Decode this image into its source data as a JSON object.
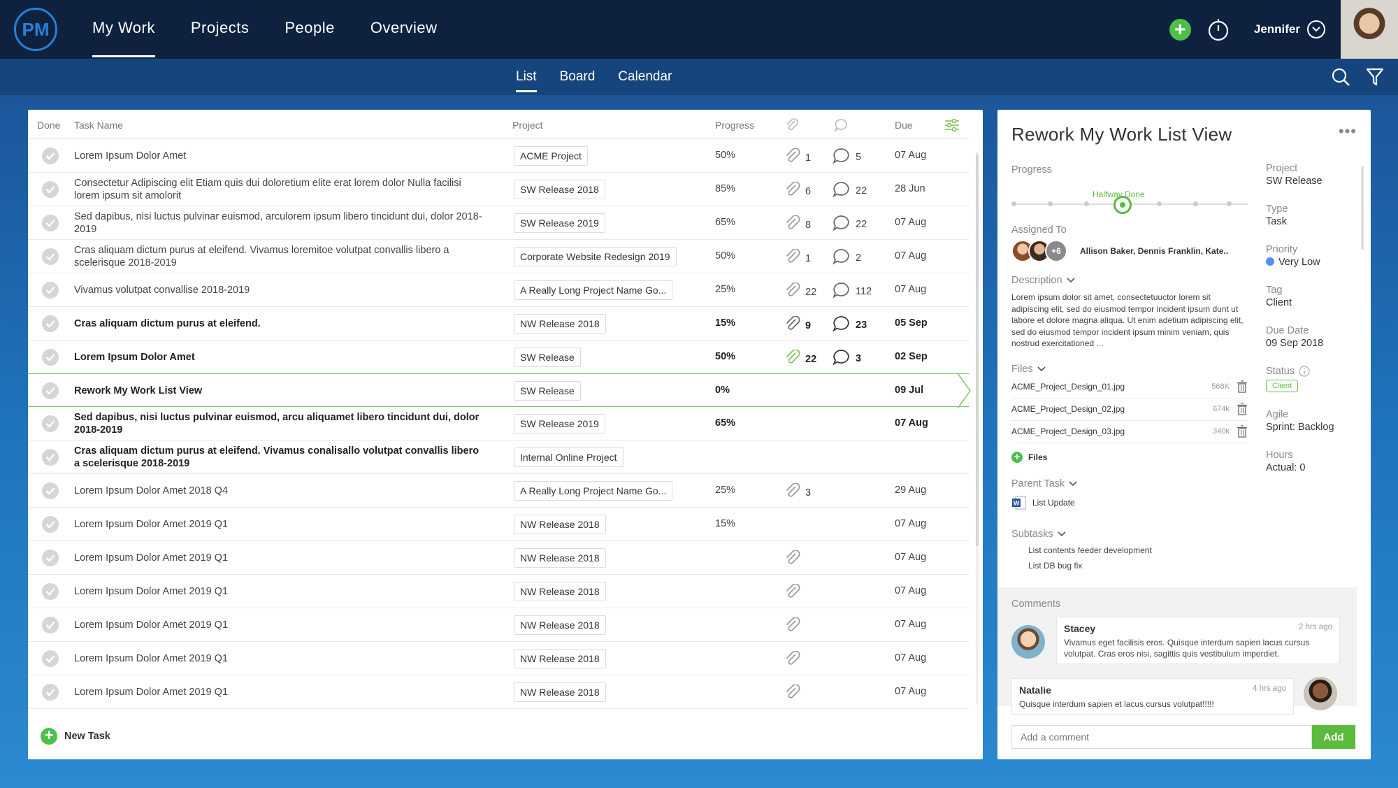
{
  "logo": "PM",
  "nav": {
    "items": [
      {
        "label": "My Work",
        "active": true
      },
      {
        "label": "Projects",
        "active": false
      },
      {
        "label": "People",
        "active": false
      },
      {
        "label": "Overview",
        "active": false
      }
    ],
    "user": "Jennifer"
  },
  "subnav": {
    "items": [
      {
        "label": "List",
        "active": true
      },
      {
        "label": "Board",
        "active": false
      },
      {
        "label": "Calendar",
        "active": false
      }
    ]
  },
  "table": {
    "headers": {
      "done": "Done",
      "task": "Task Name",
      "project": "Project",
      "progress": "Progress",
      "due": "Due"
    },
    "rows": [
      {
        "name": "Lorem Ipsum Dolor Amet",
        "project": "ACME Project",
        "progress": "50%",
        "attachments": "1",
        "comments": "5",
        "due": "07 Aug"
      },
      {
        "name": "Consectetur Adipiscing elit Etiam quis dui doloretium elite erat lorem dolor Nulla facilisi lorem ipsum sit amolorit",
        "project": "SW Release 2018",
        "progress": "85%",
        "attachments": "6",
        "comments": "22",
        "due": "28 Jun"
      },
      {
        "name": "Sed dapibus, nisi luctus pulvinar euismod, arculorem ipsum libero tincidunt dui, dolor 2018-2019",
        "project": "SW Release 2019",
        "progress": "65%",
        "attachments": "8",
        "comments": "22",
        "due": "07 Aug"
      },
      {
        "name": "Cras aliquam dictum purus at eleifend. Vivamus loremitoe volutpat convallis libero a scelerisque 2018-2019",
        "project": "Corporate Website Redesign 2019",
        "progress": "50%",
        "attachments": "1",
        "comments": "2",
        "due": "07 Aug"
      },
      {
        "name": "Vivamus volutpat convallise 2018-2019",
        "project": "A Really Long Project Name Go...",
        "progress": "25%",
        "attachments": "22",
        "comments": "112",
        "due": "07 Aug"
      },
      {
        "name": "Cras aliquam dictum purus at eleifend.",
        "project": "NW Release 2018",
        "progress": "15%",
        "attachments": "9",
        "comments": "23",
        "due": "05 Sep",
        "bold": true
      },
      {
        "name": "Lorem Ipsum Dolor Amet",
        "project": "SW Release",
        "progress": "50%",
        "attachments": "22",
        "comments": "3",
        "due": "02 Sep",
        "bold": true
      },
      {
        "name": "Rework My Work List View",
        "project": "SW Release",
        "progress": "0%",
        "attachments": "",
        "comments": "",
        "due": "09 Jul",
        "bold": true,
        "selected": true
      },
      {
        "name": "Sed dapibus, nisi luctus pulvinar euismod, arcu aliquamet libero tincidunt dui, dolor 2018-2019",
        "project": "SW Release 2019",
        "progress": "65%",
        "attachments": "",
        "comments": "",
        "due": "07 Aug",
        "bold": true
      },
      {
        "name": "Cras aliquam dictum purus at eleifend. Vivamus conalisallo volutpat convallis libero a scelerisque 2018-2019",
        "project": "Internal Online Project",
        "progress": "",
        "attachments": "",
        "comments": "",
        "due": "",
        "bold": true
      },
      {
        "name": "Lorem Ipsum Dolor Amet 2018 Q4",
        "project": "A Really Long Project Name Go...",
        "progress": "25%",
        "attachments": "3",
        "comments": "",
        "due": "29 Aug"
      },
      {
        "name": "Lorem Ipsum Dolor Amet 2019 Q1",
        "project": "NW Release 2018",
        "progress": "15%",
        "attachments": "",
        "comments": "",
        "due": "07 Aug"
      },
      {
        "name": "Lorem Ipsum Dolor Amet 2019 Q1",
        "project": "NW Release 2018",
        "progress": "",
        "attachments": "",
        "comments": "",
        "due": "07 Aug",
        "clip": true
      },
      {
        "name": "Lorem Ipsum Dolor Amet 2019 Q1",
        "project": "NW Release 2018",
        "progress": "",
        "attachments": "",
        "comments": "",
        "due": "07 Aug",
        "clip": true
      },
      {
        "name": "Lorem Ipsum Dolor Amet 2019 Q1",
        "project": "NW Release 2018",
        "progress": "",
        "attachments": "",
        "comments": "",
        "due": "07 Aug",
        "clip": true
      },
      {
        "name": "Lorem Ipsum Dolor Amet 2019 Q1",
        "project": "NW Release 2018",
        "progress": "",
        "attachments": "",
        "comments": "",
        "due": "07 Aug",
        "clip": true
      },
      {
        "name": "Lorem Ipsum Dolor Amet 2019 Q1",
        "project": "NW Release 2018",
        "progress": "",
        "attachments": "",
        "comments": "",
        "due": "07 Aug",
        "clip": true
      }
    ],
    "new_task_label": "New Task"
  },
  "detail": {
    "title": "Rework My Work List View",
    "menu": "•••",
    "progress_label": "Progress",
    "progress_caption": "Halfway Done",
    "assigned_label": "Assigned To",
    "assigned_more": "+6",
    "assigned_names": "Allison Baker, Dennis Franklin, Kate..",
    "description_label": "Description",
    "description": "Lorem ipsum dolor sit amet, consectetuuctor lorem sit adipiscing elit, sed do eiusmod tempor incident ipsum dunt ut labore et dolore magna aliqua. Ut enim adetium adipiscing elit, sed do eiusmod tempor incident ipsum minim veniam, quis nostrud exercitationed ...",
    "files_label": "Files",
    "files": [
      {
        "name": "ACME_Project_Design_01.jpg",
        "size": "568K"
      },
      {
        "name": "ACME_Project_Design_02.jpg",
        "size": "674k"
      },
      {
        "name": "ACME_Project_Design_03.jpg",
        "size": "340k"
      }
    ],
    "add_files_label": "Files",
    "parent_task_label": "Parent Task",
    "parent_task": "List Update",
    "subtasks_label": "Subtasks",
    "subtasks": [
      "List contents feeder development",
      "List DB bug fix"
    ],
    "props": {
      "project": {
        "label": "Project",
        "value": "SW Release"
      },
      "type": {
        "label": "Type",
        "value": "Task"
      },
      "priority": {
        "label": "Priority",
        "value": "Very Low"
      },
      "tag": {
        "label": "Tag",
        "value": "Client"
      },
      "due_date": {
        "label": "Due Date",
        "value": "09 Sep 2018"
      },
      "status": {
        "label": "Status",
        "value": "Client"
      },
      "agile": {
        "label": "Agile",
        "value": "Sprint: Backlog"
      },
      "hours": {
        "label": "Hours",
        "value": "Actual: 0"
      }
    },
    "comments_label": "Comments",
    "comments": [
      {
        "author": "Stacey",
        "time": "2 hrs ago",
        "text": "Vivamus eget facilisis eros. Quisque interdum sapien lacus cursus volutpat. Cras eros nisi, sagittis quis vestibulum imperdiet."
      },
      {
        "author": "Natalie",
        "time": "4 hrs ago",
        "text": "Quisque interdum sapien et lacus cursus volutpat!!!!!"
      }
    ],
    "comment_placeholder": "Add a comment",
    "add_button": "Add"
  },
  "colors": {
    "accent_green": "#5cba3c",
    "nav_dark": "#0e2240",
    "priority_blue": "#4d90ff"
  }
}
